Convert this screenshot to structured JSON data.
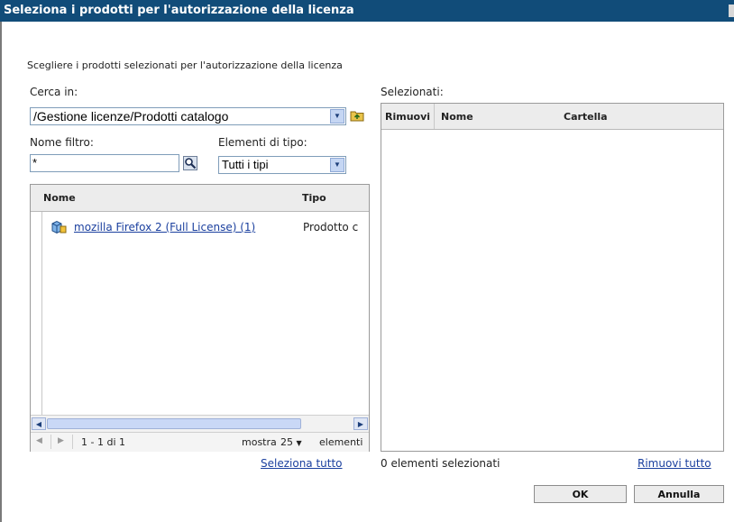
{
  "dialog": {
    "title": "Seleziona i prodotti per l'autorizzazione della licenza",
    "instructions": "Scegliere i prodotti selezionati per l'autorizzazione della licenza"
  },
  "left": {
    "search_in_label": "Cerca in:",
    "search_in_value": "/Gestione licenze/Prodotti catalogo",
    "filter_name_label": "Nome filtro:",
    "filter_name_value": "*",
    "type_label": "Elementi di tipo:",
    "type_value": "Tutti i tipi",
    "columns": {
      "name": "Nome",
      "type": "Tipo"
    },
    "rows": [
      {
        "name": "mozilla Firefox 2 (Full License) (1)",
        "type": "Prodotto c",
        "icon": "product-icon"
      }
    ],
    "pager": {
      "range": "1 - 1 di 1",
      "show_label": "mostra",
      "show_value": "25",
      "items_label": "elementi"
    },
    "select_all_link": "Seleziona tutto"
  },
  "right": {
    "selected_label": "Selezionati:",
    "columns": {
      "remove": "Rimuovi",
      "name": "Nome",
      "folder": "Cartella"
    },
    "count_text": "0 elementi selezionati",
    "remove_all_link": "Rimuovi tutto"
  },
  "buttons": {
    "ok": "OK",
    "cancel": "Annulla"
  },
  "colors": {
    "titlebar": "#114c79",
    "link": "#1a3f9e"
  }
}
